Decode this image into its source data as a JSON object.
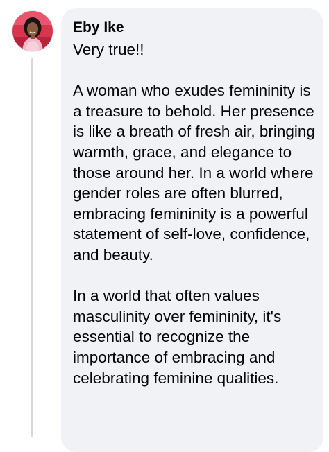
{
  "comment": {
    "author": "Eby Ike",
    "avatar_icon": "profile-photo-avatar",
    "paragraphs": [
      "Very true!!",
      "A woman who exudes femininity is a treasure to behold. Her presence is like a breath of fresh air, bringing warmth, grace, and elegance to those around her. In a world where gender roles are often blurred, embracing femininity is a powerful statement of self-love, confidence, and beauty.",
      "In a world that often values masculinity over femininity, it's essential to recognize the importance of embracing and celebrating feminine qualities."
    ]
  },
  "colors": {
    "bubble_bg": "#f0f2f5",
    "text": "#050505",
    "thread_line": "#d4d7dc",
    "avatar_bg": "#d9354f"
  }
}
